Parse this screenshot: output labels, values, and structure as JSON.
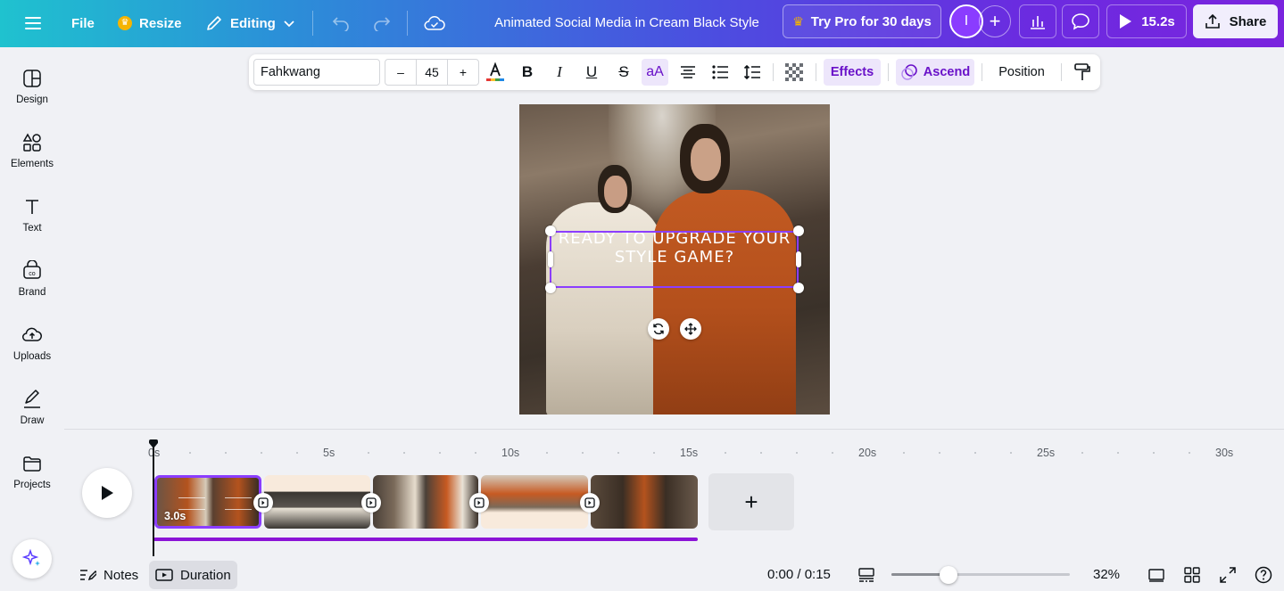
{
  "topbar": {
    "menu_icon": "hamburger-icon",
    "file_label": "File",
    "resize_label": "Resize",
    "editing_label": "Editing",
    "doc_title": "Animated Social Media in Cream Black Style",
    "pro_label": "Try Pro for 30 days",
    "avatar_initial": "I",
    "play_duration": "15.2s",
    "share_label": "Share"
  },
  "sidebar": {
    "items": [
      {
        "label": "Design",
        "icon": "design-icon"
      },
      {
        "label": "Elements",
        "icon": "elements-icon"
      },
      {
        "label": "Text",
        "icon": "text-icon"
      },
      {
        "label": "Brand",
        "icon": "brand-icon"
      },
      {
        "label": "Uploads",
        "icon": "uploads-icon"
      },
      {
        "label": "Draw",
        "icon": "draw-icon"
      },
      {
        "label": "Projects",
        "icon": "projects-icon"
      }
    ]
  },
  "text_toolbar": {
    "font_name": "Fahkwang",
    "font_size": "45",
    "minus": "–",
    "plus": "+",
    "case_label": "aA",
    "effects_label": "Effects",
    "animation_label": "Ascend",
    "position_label": "Position",
    "colors": {
      "accent": "#8b3dff",
      "pill_bg": "#ede6fb",
      "pill_text": "#6a12c9"
    }
  },
  "canvas": {
    "text": "READY TO UPGRADE YOUR STYLE GAME?"
  },
  "timeline": {
    "ticks": [
      "0s",
      "5s",
      "10s",
      "15s",
      "20s",
      "25s",
      "30s"
    ],
    "clips": [
      {
        "duration": "3.0s",
        "selected": true
      },
      {
        "duration": "",
        "selected": false
      },
      {
        "duration": "",
        "selected": false
      },
      {
        "duration": "",
        "selected": false
      },
      {
        "duration": "",
        "selected": false
      }
    ],
    "add_label": "+"
  },
  "bottombar": {
    "notes_label": "Notes",
    "duration_label": "Duration",
    "time_readout": "0:00 / 0:15",
    "zoom_percent": "32%",
    "zoom_level": 0.32
  }
}
